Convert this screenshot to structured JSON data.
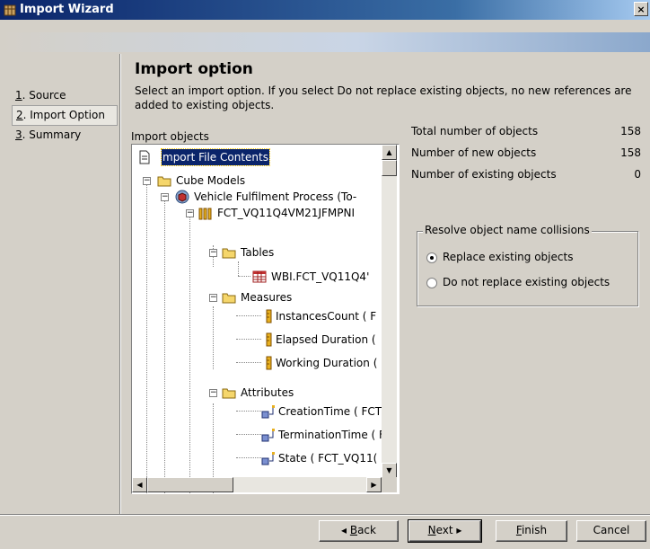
{
  "window": {
    "title": "Import Wizard",
    "close_label": "×"
  },
  "nav": {
    "items": [
      {
        "key": "1",
        "rest": ". Source"
      },
      {
        "key": "2",
        "rest": ". Import Option"
      },
      {
        "key": "3",
        "rest": ". Summary"
      }
    ]
  },
  "main": {
    "heading": "Import option",
    "description": "Select an import option. If you select Do not replace existing objects, no new references are added to existing objects.",
    "objects_label": "Import objects"
  },
  "tree": {
    "root": "mport File Contents",
    "cube_models": "Cube Models",
    "process": "Vehicle Fulfilment Process (To-",
    "fact": "FCT_VQ11Q4VM21JFMPNI",
    "tables": "Tables",
    "table1": "WBI.FCT_VQ11Q4'",
    "measures": "Measures",
    "m1": "InstancesCount ( F",
    "m2": "Elapsed Duration (",
    "m3": "Working Duration (",
    "attributes": "Attributes",
    "a1": "CreationTime ( FCT",
    "a2": "TerminationTime ( F",
    "a3": "State ( FCT_VQ11("
  },
  "stats": [
    {
      "label": "Total number of objects",
      "value": "158"
    },
    {
      "label": "Number of new objects",
      "value": "158"
    },
    {
      "label": "Number of existing objects",
      "value": "0"
    }
  ],
  "collisions": {
    "legend": "Resolve object name collisions",
    "options": [
      "Replace existing objects",
      "Do not replace existing objects"
    ],
    "selected": "Replace existing objects"
  },
  "buttons": {
    "back_pre": "◂ ",
    "back_key": "B",
    "back_rest": "ack",
    "next_key": "N",
    "next_rest": "ext ▸",
    "finish_key": "F",
    "finish_rest": "inish",
    "cancel": "Cancel"
  }
}
